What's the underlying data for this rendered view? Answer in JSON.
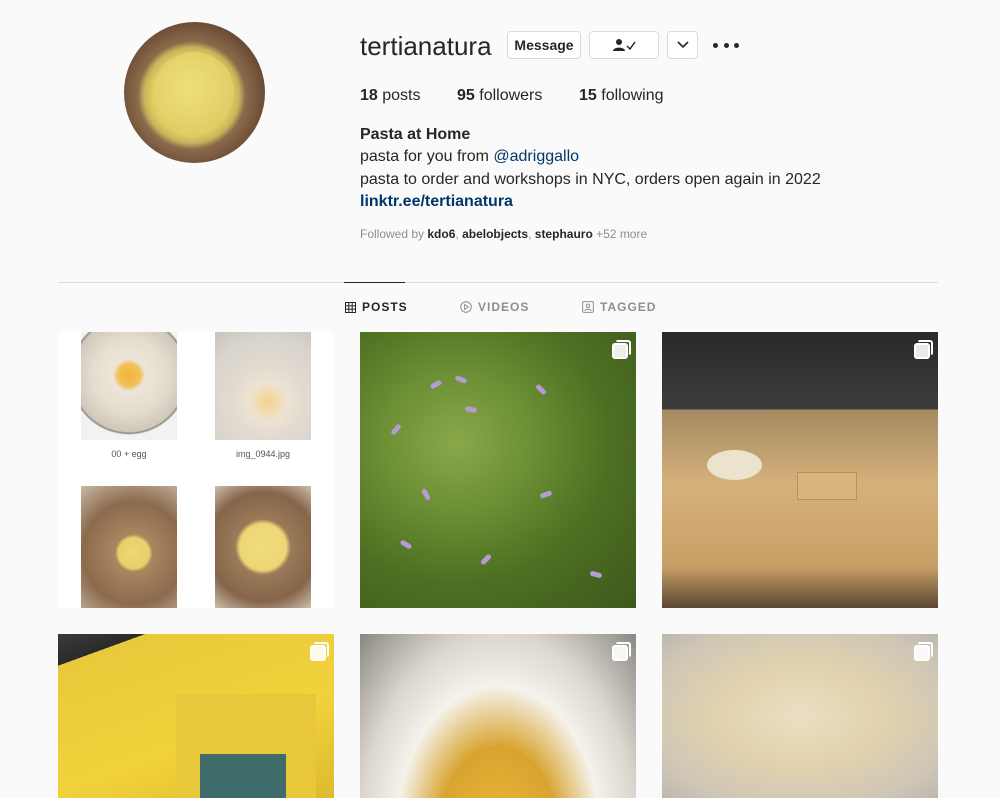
{
  "profile": {
    "username": "tertianatura",
    "message_label": "Message",
    "posts_count": "18",
    "posts_label": "posts",
    "followers_count": "95",
    "followers_label": "followers",
    "following_count": "15",
    "following_label": "following"
  },
  "bio": {
    "name": "Pasta at Home",
    "line1_prefix": "pasta for you from ",
    "line1_mention": "@adriggallo",
    "line2": "pasta to order and workshops in NYC, orders open again in 2022",
    "link": "linktr.ee/tertianatura",
    "followed_by_prefix": "Followed by ",
    "followed_users": [
      "kdo6",
      "abelobjects",
      "stephauro"
    ],
    "followed_more": "+52 more"
  },
  "tabs": [
    {
      "label": "POSTS",
      "icon": "grid-icon",
      "active": true
    },
    {
      "label": "VIDEOS",
      "icon": "play-circle-icon",
      "active": false
    },
    {
      "label": "TAGGED",
      "icon": "tag-person-icon",
      "active": false
    }
  ],
  "collage": {
    "captions": [
      "00 + egg",
      "img_0944.jpg"
    ]
  },
  "colors": {
    "link": "#00376b",
    "muted": "#8e8e8e",
    "text": "#262626",
    "border": "#dbdbdb"
  }
}
